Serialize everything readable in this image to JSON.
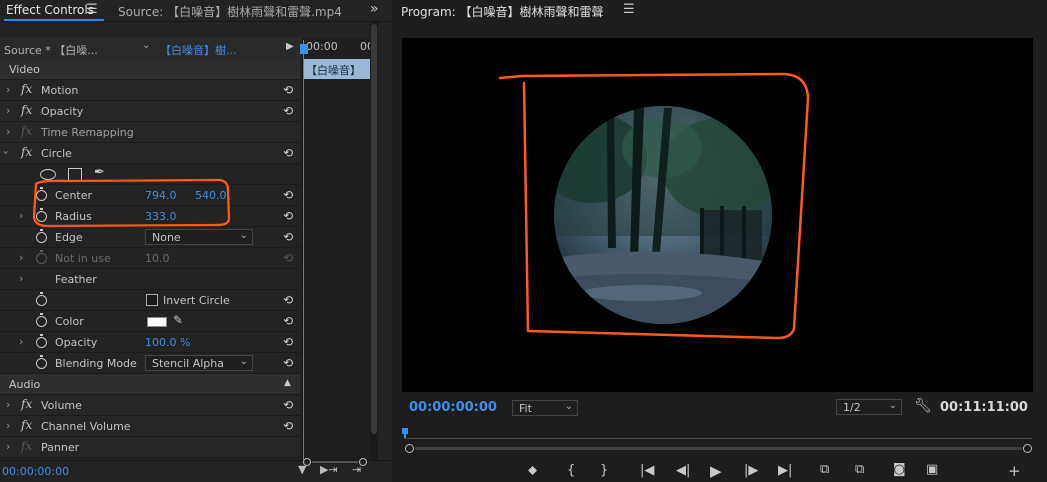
{
  "left_panel": {
    "tab_active": "Effect Controls",
    "tab_source": "Source: 【白噪音】樹林雨聲和雷聲.mp4",
    "overflow_icon": "»",
    "source_label": "Source * 【白噪...",
    "source_clip": "【白噪音】樹...",
    "timeline_start": "00:00",
    "timeline_end": "00",
    "clip_label": "【白噪音】",
    "bottom_timecode": "00:00:00:00"
  },
  "sections": {
    "video": "Video",
    "audio": "Audio"
  },
  "effects": {
    "motion": "Motion",
    "opacity": "Opacity",
    "time_remapping": "Time Remapping",
    "circle": "Circle",
    "volume": "Volume",
    "channel_volume": "Channel Volume",
    "panner": "Panner"
  },
  "circle_props": {
    "center_label": "Center",
    "center_x": "794.0",
    "center_y": "540.0",
    "radius_label": "Radius",
    "radius_value": "333.0",
    "edge_label": "Edge",
    "edge_value": "None",
    "not_in_use_label": "Not in use",
    "not_in_use_value": "10.0",
    "feather_label": "Feather",
    "invert_label": "Invert Circle",
    "color_label": "Color",
    "opacity_label": "Opacity",
    "opacity_value": "100.0 %",
    "blend_label": "Blending Mode",
    "blend_value": "Stencil Alpha",
    "color_swatch": "#ffffff"
  },
  "program": {
    "title": "Program: 【白噪音】樹林雨聲和雷聲",
    "timecode_current": "00:00:00:00",
    "fit": "Fit",
    "resolution": "1/2",
    "timecode_duration": "00:11:11:00"
  },
  "colors": {
    "accent": "#3c8ee6",
    "annotation": "#ff5a1a"
  }
}
